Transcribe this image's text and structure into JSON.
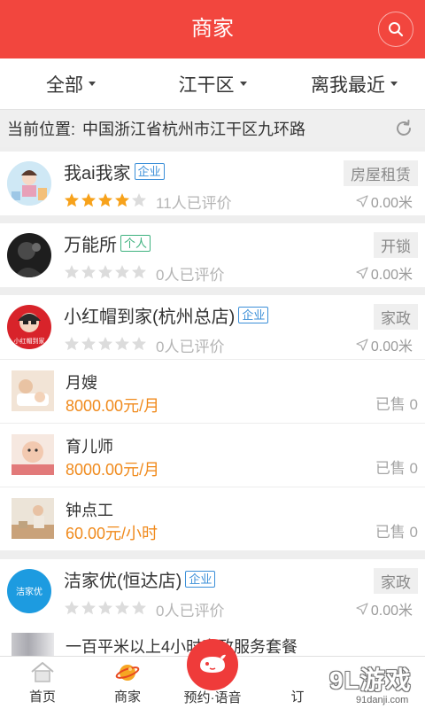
{
  "header": {
    "title": "商家"
  },
  "filters": [
    {
      "label": "全部"
    },
    {
      "label": "江干区"
    },
    {
      "label": "离我最近"
    }
  ],
  "location": {
    "label": "当前位置:",
    "address": "中国浙江省杭州市江干区九环路"
  },
  "shops": [
    {
      "name": "我ai我家",
      "badge": "企业",
      "tag": "房屋租赁",
      "rating": 4,
      "reviews": "11人已评价",
      "distance": "0.00米"
    },
    {
      "name": "万能所",
      "badge": "个人",
      "tag": "开锁",
      "rating": 0,
      "reviews": "0人已评价",
      "distance": "0.00米"
    },
    {
      "name": "小红帽到家(杭州总店)",
      "badge": "企业",
      "tag": "家政",
      "rating": 0,
      "reviews": "0人已评价",
      "distance": "0.00米",
      "avatar_text": "小红帽到家",
      "services": [
        {
          "name": "月嫂",
          "price": "8000.00元/月",
          "sold": "已售 0"
        },
        {
          "name": "育儿师",
          "price": "8000.00元/月",
          "sold": "已售 0"
        },
        {
          "name": "钟点工",
          "price": "60.00元/小时",
          "sold": "已售 0"
        }
      ]
    },
    {
      "name": "洁家优(恒达店)",
      "badge": "企业",
      "tag": "家政",
      "rating": 0,
      "reviews": "0人已评价",
      "distance": "0.00米",
      "avatar_text": "洁家优"
    }
  ],
  "partial_service": {
    "name": "一百平米以上4小时家政服务套餐"
  },
  "bottom_nav": {
    "home": "首页",
    "merchants": "商家",
    "center": "预约·语音",
    "orders": "订"
  },
  "watermark": {
    "logo": "9L游戏",
    "url": "91danji.com"
  },
  "colors": {
    "primary": "#f2463e",
    "price": "#f08a1c",
    "star": "#f7a21b",
    "badge": "#3b8fd8",
    "badge_personal": "#3fb27f"
  }
}
